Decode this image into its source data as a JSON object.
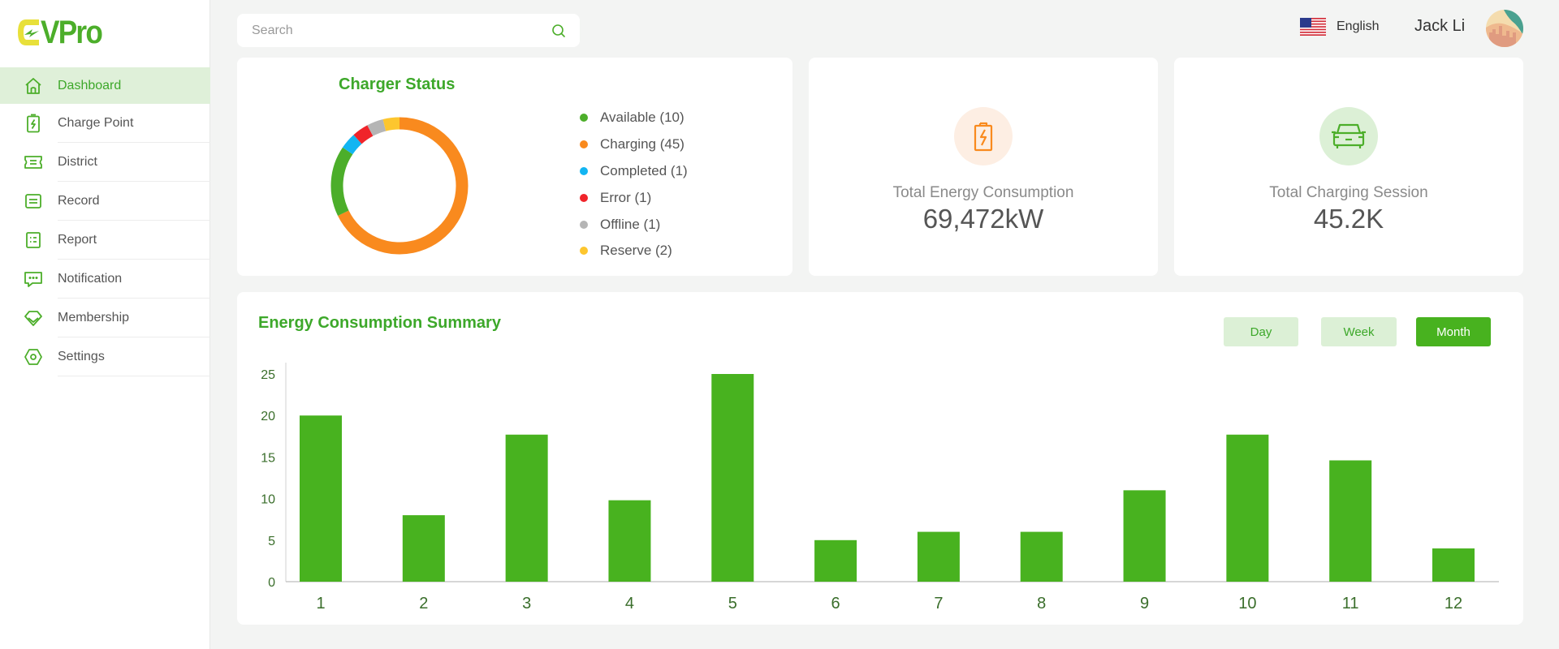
{
  "brand": {
    "logo_text": "VPro",
    "logo_initial": "E"
  },
  "sidebar": {
    "items": [
      {
        "id": "dashboard",
        "label": "Dashboard",
        "icon": "home-icon",
        "active": true
      },
      {
        "id": "charge-point",
        "label": "Charge Point",
        "icon": "battery-charge-icon",
        "active": false
      },
      {
        "id": "district",
        "label": "District",
        "icon": "ticket-icon",
        "active": false
      },
      {
        "id": "record",
        "label": "Record",
        "icon": "record-icon",
        "active": false
      },
      {
        "id": "report",
        "label": "Report",
        "icon": "report-list-icon",
        "active": false
      },
      {
        "id": "notification",
        "label": "Notification",
        "icon": "chat-bubble-icon",
        "active": false
      },
      {
        "id": "membership",
        "label": "Membership",
        "icon": "diamond-icon",
        "active": false
      },
      {
        "id": "settings",
        "label": "Settings",
        "icon": "hexagon-gear-icon",
        "active": false
      }
    ]
  },
  "topbar": {
    "search_placeholder": "Search",
    "search_value": "",
    "language": "English",
    "user_name": "Jack Li"
  },
  "colors": {
    "brand_green": "#48b21f",
    "brand_yellow": "#e8e03a",
    "light_green": "#dcf0d6",
    "orange": "#f98a1e"
  },
  "charger_status": {
    "title": "Charger Status",
    "items": [
      {
        "label": "Available (10)",
        "name": "Available",
        "value": 10,
        "color": "#4cae2a"
      },
      {
        "label": "Charging (45)",
        "name": "Charging",
        "value": 45,
        "color": "#f98a1e"
      },
      {
        "label": "Completed (1)",
        "name": "Completed",
        "value": 1,
        "color": "#12b5f2"
      },
      {
        "label": "Error (1)",
        "name": "Error",
        "value": 1,
        "color": "#f0242a"
      },
      {
        "label": "Offline (1)",
        "name": "Offline",
        "value": 1,
        "color": "#b5b5b5"
      },
      {
        "label": "Reserve (2)",
        "name": "Reserve",
        "value": 2,
        "color": "#fdc62e"
      }
    ],
    "ring_order": [
      "Charging",
      "Available",
      "Completed",
      "Error",
      "Offline",
      "Reserve"
    ]
  },
  "stats": {
    "energy": {
      "label": "Total Energy Consumption",
      "value": "69,472kW",
      "icon": "battery-charge-icon"
    },
    "session": {
      "label": "Total Charging Session",
      "value": "45.2K",
      "icon": "car-icon"
    }
  },
  "summary": {
    "title": "Energy Consumption Summary",
    "periods": [
      {
        "label": "Day",
        "active": false
      },
      {
        "label": "Week",
        "active": false
      },
      {
        "label": "Month",
        "active": true
      }
    ]
  },
  "chart_data": [
    {
      "type": "pie",
      "title": "Charger Status",
      "variant": "donut",
      "categories": [
        "Charging",
        "Available",
        "Completed",
        "Error",
        "Offline",
        "Reserve"
      ],
      "values": [
        45,
        10,
        1,
        1,
        1,
        2
      ],
      "legend": "right"
    },
    {
      "type": "bar",
      "title": "Energy Consumption Summary",
      "categories": [
        "1",
        "2",
        "3",
        "4",
        "5",
        "6",
        "7",
        "8",
        "9",
        "10",
        "11",
        "12"
      ],
      "values": [
        20,
        8,
        17.7,
        9.8,
        25,
        5,
        6,
        6,
        11,
        17.7,
        14.6,
        4
      ],
      "xlabel": "",
      "ylabel": "",
      "ylim": [
        0,
        25
      ],
      "yticks": [
        0,
        5,
        10,
        15,
        20,
        25
      ],
      "grid": false,
      "color": "#48b21f"
    }
  ]
}
